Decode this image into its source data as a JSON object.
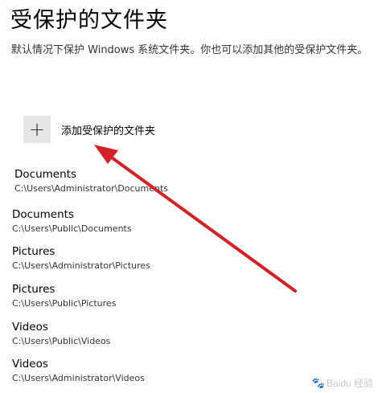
{
  "page": {
    "title": "受保护的文件夹",
    "description": "默认情况下保护 Windows 系统文件夹。你也可以添加其他的受保护文件夹。"
  },
  "add_button": {
    "icon": "plus-icon",
    "label": "添加受保护的文件夹"
  },
  "folders": [
    {
      "name": "Documents",
      "path": "C:\\Users\\Administrator\\Documents"
    },
    {
      "name": "Documents",
      "path": "C:\\Users\\Public\\Documents"
    },
    {
      "name": "Pictures",
      "path": "C:\\Users\\Administrator\\Pictures"
    },
    {
      "name": "Pictures",
      "path": "C:\\Users\\Public\\Pictures"
    },
    {
      "name": "Videos",
      "path": "C:\\Users\\Public\\Videos"
    },
    {
      "name": "Videos",
      "path": "C:\\Users\\Administrator\\Videos"
    }
  ],
  "annotation": {
    "arrow_color": "#d42027"
  },
  "watermark": {
    "text": "Baidu 经验"
  }
}
